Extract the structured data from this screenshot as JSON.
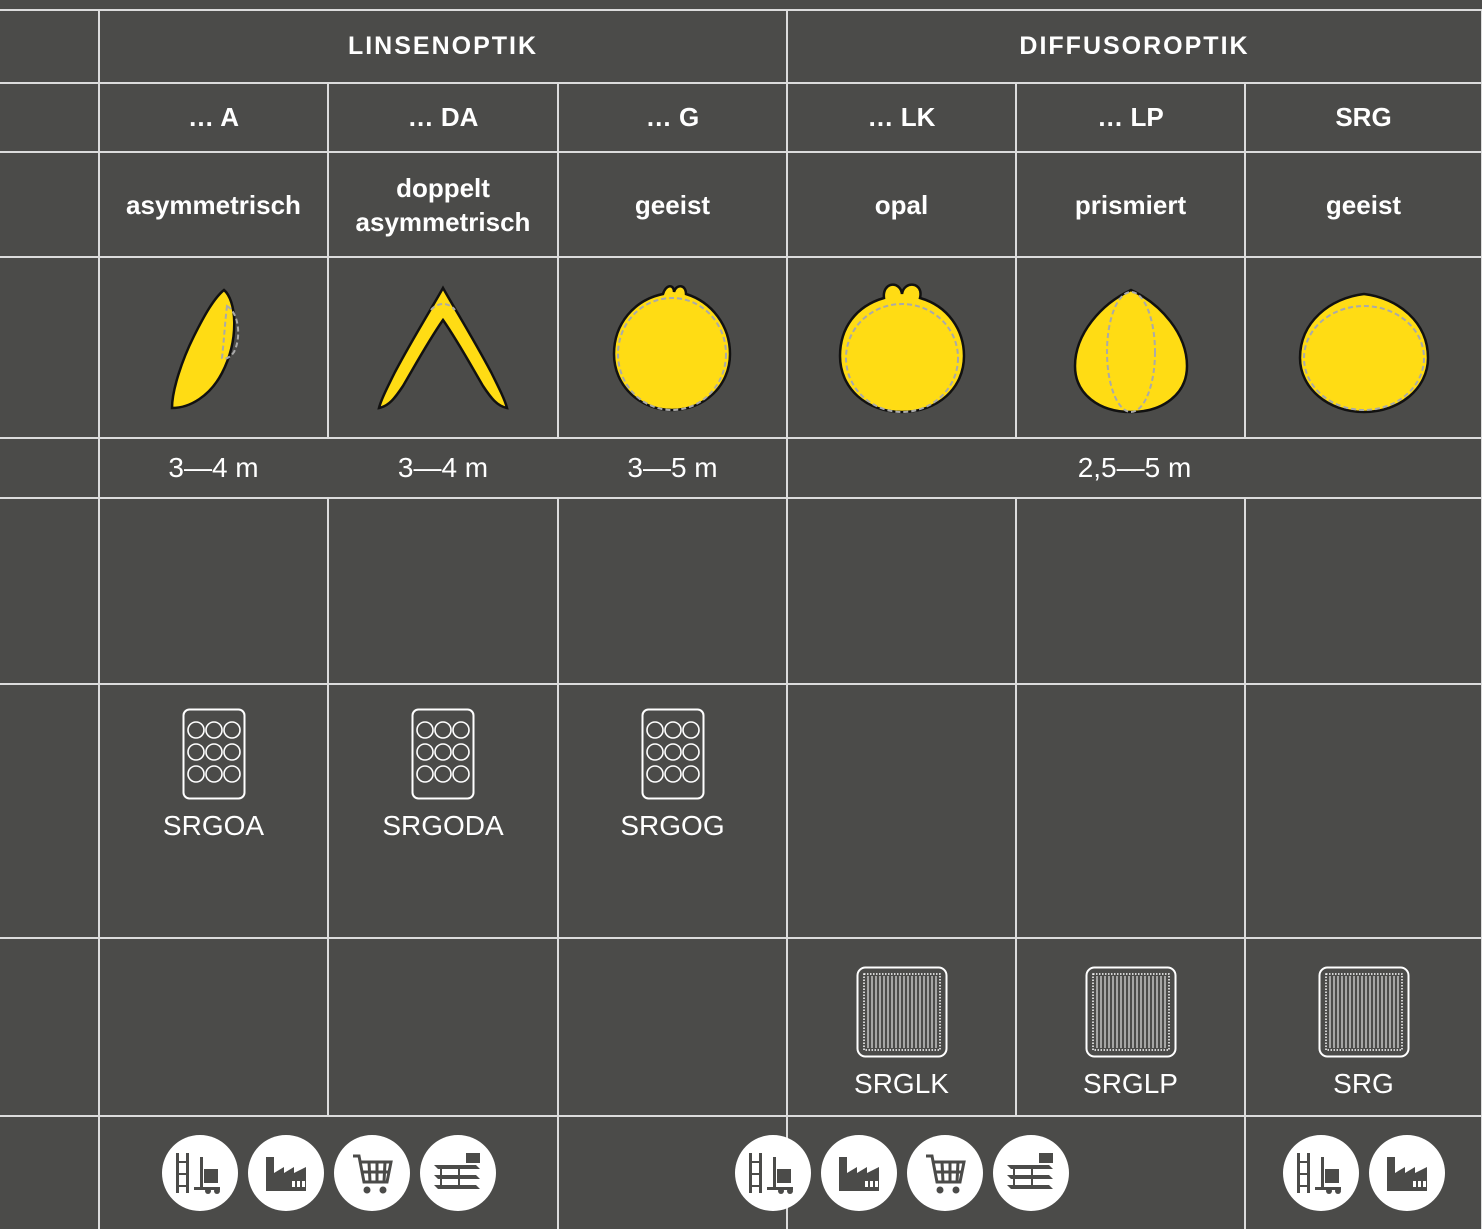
{
  "colors": {
    "background": "#4b4b49",
    "grid": "#dcdcdc",
    "curve": "#ffdc14",
    "text": "#ffffff"
  },
  "groups": {
    "lens": "LINSENOPTIK",
    "diffuser": "DIFFUSOROPTIK"
  },
  "columns": [
    {
      "code": "… A",
      "desc_line1": "asymmetrisch",
      "desc_line2": "",
      "curve": "asymmetric-curve-icon"
    },
    {
      "code": "… DA",
      "desc_line1": "doppelt",
      "desc_line2": "asymmetrisch",
      "curve": "double-asymmetric-curve-icon"
    },
    {
      "code": "… G",
      "desc_line1": "geeist",
      "desc_line2": "",
      "curve": "frosted-curve-icon"
    },
    {
      "code": "… LK",
      "desc_line1": "opal",
      "desc_line2": "",
      "curve": "opal-curve-icon"
    },
    {
      "code": "… LP",
      "desc_line1": "prismiert",
      "desc_line2": "",
      "curve": "prismatic-curve-icon"
    },
    {
      "code": "SRG",
      "desc_line1": "geeist",
      "desc_line2": "",
      "curve": "srg-frosted-curve-icon"
    }
  ],
  "ranges": {
    "a": "3—4 m",
    "da": "3—4 m",
    "g": "3—5 m",
    "diffuser": "2,5—5 m"
  },
  "lens_models": [
    "SRGOA",
    "SRGODA",
    "SRGOG"
  ],
  "diffuser_models": [
    "SRGLK",
    "SRGLP",
    "SRG"
  ],
  "applications": {
    "group1": [
      "warehouse-forklift-icon",
      "factory-icon",
      "shopping-cart-icon",
      "classroom-icon"
    ],
    "group2": [
      "warehouse-forklift-icon",
      "factory-icon",
      "shopping-cart-icon",
      "classroom-icon"
    ],
    "group3": [
      "warehouse-forklift-icon",
      "factory-icon"
    ]
  }
}
